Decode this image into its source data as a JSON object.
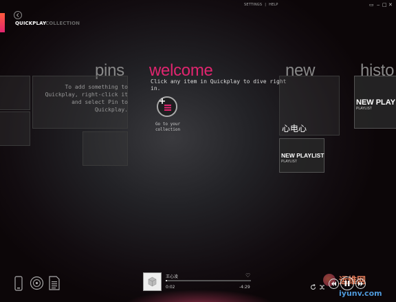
{
  "window": {
    "top_links": [
      "SETTINGS",
      "|",
      "HELP"
    ],
    "controls": [
      "▭",
      "‒",
      "□",
      "✕"
    ]
  },
  "nav": {
    "tabs": [
      {
        "label": "QUICKPLAY",
        "active": true
      },
      {
        "label": "COLLECTION",
        "active": false
      }
    ]
  },
  "sections": {
    "pins": {
      "heading": "pins",
      "text": "To add something to\nQuickplay, right-click it\nand select Pin to\nQuickplay."
    },
    "welcome": {
      "heading": "welcome",
      "text": "Click any item in Quickplay to dive right\nin.",
      "go_caption": "Go to your\ncollection"
    },
    "new": {
      "heading": "new",
      "album_title": "心电心",
      "playlist_title": "NEW PLAYLIST",
      "playlist_sub": "PLAYLIST"
    },
    "history": {
      "heading": "histo",
      "playlist_title": "NEW PLAY",
      "playlist_sub": "PLAYLIST"
    }
  },
  "now_playing": {
    "title": "王心凌",
    "elapsed": "0:02",
    "remaining": "-4:29",
    "progress": 0.01
  },
  "watermark": {
    "line1": "运维网",
    "line2": "iyunv.com"
  },
  "colors": {
    "accent": "#e0256f",
    "accent_orange": "#ff5a3c",
    "background": "#0c0608"
  },
  "icons": [
    "back-arrow-icon",
    "phone-icon",
    "disc-icon",
    "playlist-doc-icon",
    "heart-icon",
    "repeat-icon",
    "shuffle-icon",
    "previous-icon",
    "pause-icon",
    "next-icon",
    "add-collection-icon"
  ]
}
